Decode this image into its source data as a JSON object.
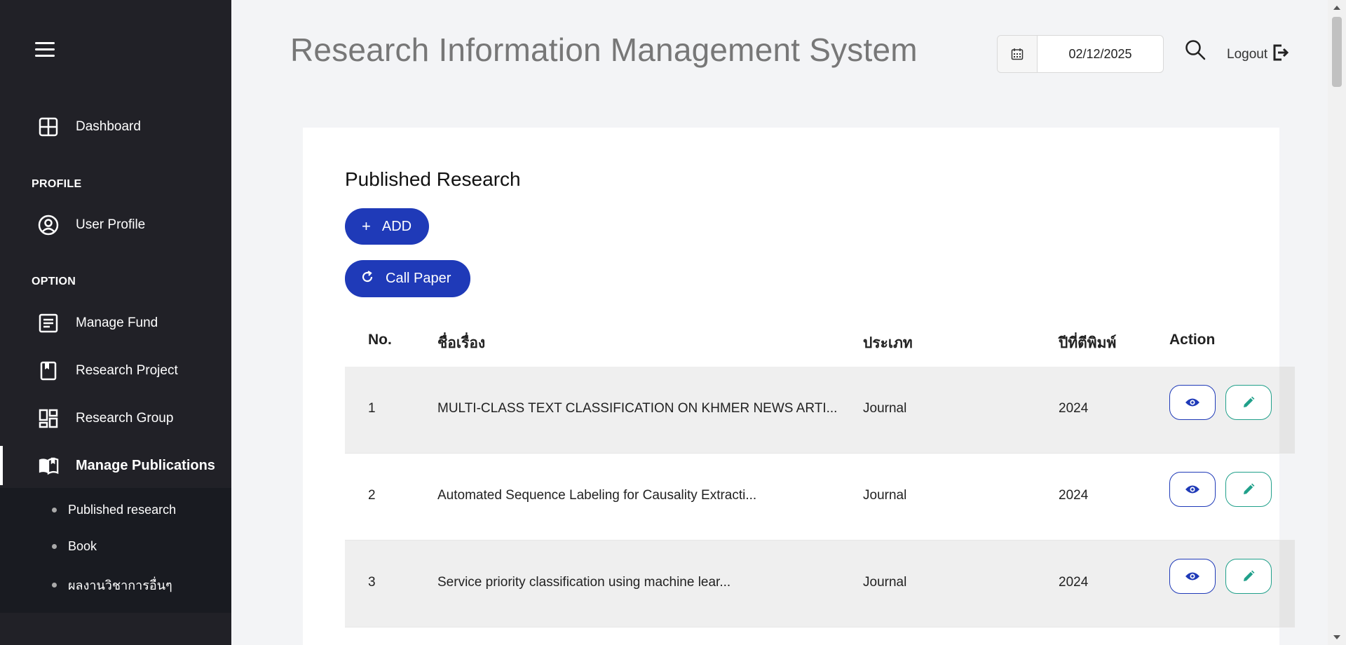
{
  "sidebar": {
    "dashboard": "Dashboard",
    "section_profile": "PROFILE",
    "user_profile": "User Profile",
    "section_option": "OPTION",
    "manage_fund": "Manage Fund",
    "research_project": "Research Project",
    "research_group": "Research Group",
    "manage_publications": "Manage Publications",
    "submenu": [
      "Published research",
      "Book",
      "ผลงานวิชาการอื่นๆ"
    ]
  },
  "header": {
    "title": "Research Information Management System",
    "date": "02/12/2025",
    "logout": "Logout"
  },
  "card": {
    "title": "Published Research",
    "add_label": "ADD",
    "call_paper_label": "Call Paper"
  },
  "table": {
    "headers": [
      "No.",
      "ชื่อเรื่อง",
      "ประเภท",
      "ปีที่ตีพิมพ์",
      "Action"
    ],
    "rows": [
      {
        "no": "1",
        "title": "MULTI-CLASS TEXT CLASSIFICATION ON KHMER NEWS ARTI...",
        "type": "Journal",
        "year": "2024"
      },
      {
        "no": "2",
        "title": "Automated Sequence Labeling for Causality Extracti...",
        "type": "Journal",
        "year": "2024"
      },
      {
        "no": "3",
        "title": "Service priority classification using machine lear...",
        "type": "Journal",
        "year": "2024"
      }
    ]
  },
  "colors": {
    "sidebar_bg": "#212127",
    "primary": "#1f3ab8",
    "edit": "#20a08a"
  }
}
